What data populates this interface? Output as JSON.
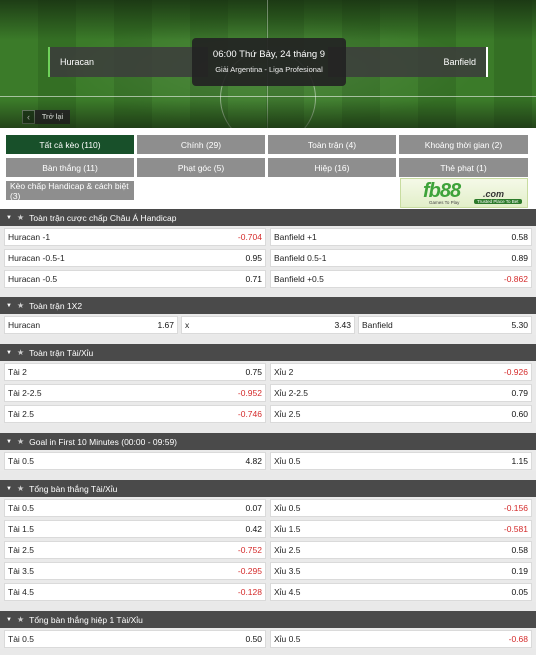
{
  "match": {
    "home_team": "Huracan",
    "away_team": "Banfield",
    "datetime": "06:00 Thứ Bảy, 24 tháng 9",
    "league": "Giải Argentina - Liga Profesional",
    "back_label": "Trở lại"
  },
  "filters": [
    {
      "label": "Tất cả kèo (110)",
      "active": true
    },
    {
      "label": "Chính (29)",
      "active": false
    },
    {
      "label": "Toàn trận (4)",
      "active": false
    },
    {
      "label": "Khoảng thời gian (2)",
      "active": false
    },
    {
      "label": "Bàn thắng (11)",
      "active": false
    },
    {
      "label": "Phạt góc (5)",
      "active": false
    },
    {
      "label": "Hiệp (16)",
      "active": false
    },
    {
      "label": "Thẻ phạt (1)",
      "active": false
    },
    {
      "label": "Kèo chấp Handicap & cách biệt (3)",
      "active": false
    }
  ],
  "banner": {
    "logo_text": "fb88",
    "logo_suffix": ".com",
    "tagline": "Games To Play",
    "tagline2": "Trusted Place To Bet"
  },
  "markets": [
    {
      "title": "Toàn trận cược chấp Châu Á Handicap",
      "cols": 2,
      "rows": [
        [
          {
            "label": "Huracan -1",
            "odd": "-0.704"
          },
          {
            "label": "Banfield +1",
            "odd": "0.58"
          }
        ],
        [
          {
            "label": "Huracan -0.5-1",
            "odd": "0.95"
          },
          {
            "label": "Banfield 0.5-1",
            "odd": "0.89"
          }
        ],
        [
          {
            "label": "Huracan -0.5",
            "odd": "0.71"
          },
          {
            "label": "Banfield +0.5",
            "odd": "-0.862"
          }
        ]
      ]
    },
    {
      "title": "Toàn trận 1X2",
      "cols": 3,
      "rows": [
        [
          {
            "label": "Huracan",
            "odd": "1.67"
          },
          {
            "label": "x",
            "odd": "3.43"
          },
          {
            "label": "Banfield",
            "odd": "5.30"
          }
        ]
      ]
    },
    {
      "title": "Toàn trận Tài/Xỉu",
      "cols": 2,
      "rows": [
        [
          {
            "label": "Tài 2",
            "odd": "0.75"
          },
          {
            "label": "Xỉu 2",
            "odd": "-0.926"
          }
        ],
        [
          {
            "label": "Tài 2-2.5",
            "odd": "-0.952"
          },
          {
            "label": "Xỉu 2-2.5",
            "odd": "0.79"
          }
        ],
        [
          {
            "label": "Tài 2.5",
            "odd": "-0.746"
          },
          {
            "label": "Xỉu 2.5",
            "odd": "0.60"
          }
        ]
      ]
    },
    {
      "title": "Goal in First 10 Minutes (00:00 - 09:59)",
      "cols": 2,
      "rows": [
        [
          {
            "label": "Tài 0.5",
            "odd": "4.82"
          },
          {
            "label": "Xỉu 0.5",
            "odd": "1.15"
          }
        ]
      ]
    },
    {
      "title": "Tổng bàn thắng Tài/Xỉu",
      "cols": 2,
      "rows": [
        [
          {
            "label": "Tài 0.5",
            "odd": "0.07"
          },
          {
            "label": "Xỉu 0.5",
            "odd": "-0.156"
          }
        ],
        [
          {
            "label": "Tài 1.5",
            "odd": "0.42"
          },
          {
            "label": "Xỉu 1.5",
            "odd": "-0.581"
          }
        ],
        [
          {
            "label": "Tài 2.5",
            "odd": "-0.752"
          },
          {
            "label": "Xỉu 2.5",
            "odd": "0.58"
          }
        ],
        [
          {
            "label": "Tài 3.5",
            "odd": "-0.295"
          },
          {
            "label": "Xỉu 3.5",
            "odd": "0.19"
          }
        ],
        [
          {
            "label": "Tài 4.5",
            "odd": "-0.128"
          },
          {
            "label": "Xỉu 4.5",
            "odd": "0.05"
          }
        ]
      ]
    },
    {
      "title": "Tổng bàn thắng hiệp 1 Tài/Xỉu",
      "cols": 2,
      "rows": [
        [
          {
            "label": "Tài 0.5",
            "odd": "0.50"
          },
          {
            "label": "Xỉu 0.5",
            "odd": "-0.68"
          }
        ]
      ]
    }
  ]
}
